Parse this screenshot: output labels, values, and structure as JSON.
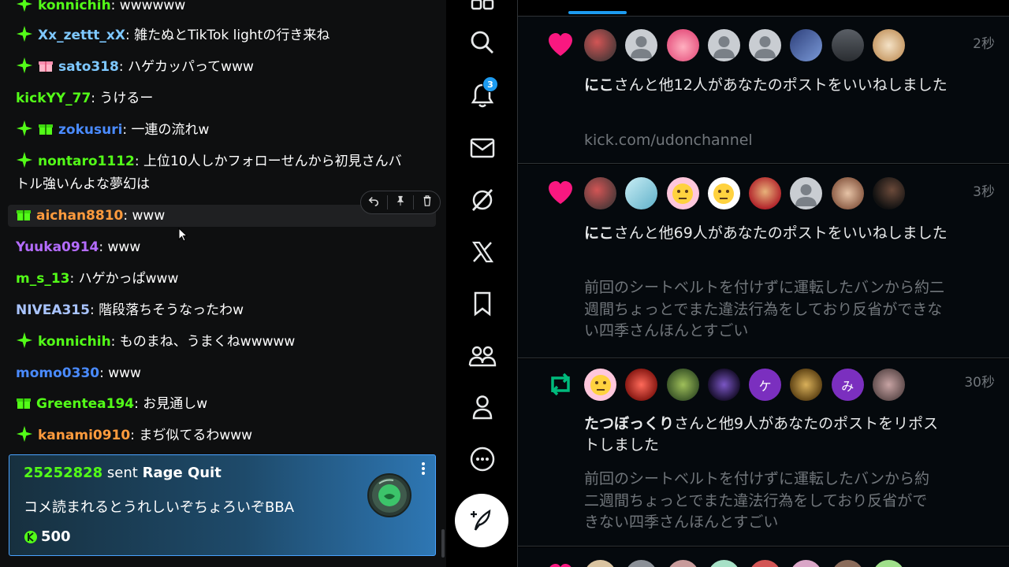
{
  "chat": {
    "messages": [
      {
        "user": "konnichih",
        "text": ": wwwwww",
        "user_color": "#53fc18",
        "badge": "kick-badge"
      },
      {
        "user": "Xx_zettt_xX",
        "text": ": 雑たぬとTikTok lightの行き来ね",
        "user_color": "#7ec8ff",
        "badge": "kick-badge"
      },
      {
        "user": "sato318",
        "text": ": ハゲカッパってwww",
        "user_color": "#7ec8ff",
        "badge": "kick-badge",
        "badge2": "pink-gift-badge"
      },
      {
        "user": "kickYY_77",
        "text": ": うけるー",
        "user_color": "#53fc18"
      },
      {
        "user": "zokusuri",
        "text": ": 一連の流れw",
        "user_color": "#4a8bff",
        "badge": "kick-badge",
        "badge2": "green-gift-badge"
      },
      {
        "user": "nontaro1112",
        "text": ": 上位10人しかフォローせんから初見さんバ",
        "text2": "トル強いんよな夢幻は",
        "user_color": "#53fc18",
        "badge": "kick-badge"
      },
      {
        "user": "aichan8810",
        "text": ": www",
        "user_color": "#ff9b3d",
        "badge": "green-gift-badge"
      },
      {
        "user": "Yuuka0914",
        "text": ": www",
        "user_color": "#b46cff"
      },
      {
        "user": "m_s_13",
        "text": ": ハゲかっぱwww",
        "user_color": "#53fc18"
      },
      {
        "user": "NIVEA315",
        "text": ": 階段落ちそうなったわw",
        "user_color": "#a9c4ff"
      },
      {
        "user": "konnichih",
        "text": ": ものまね、うまくねwwwww",
        "user_color": "#53fc18",
        "badge": "kick-badge"
      },
      {
        "user": "momo0330",
        "text": ": www",
        "user_color": "#4a8bff"
      },
      {
        "user": "Greentea194",
        "text": ": お見通しw",
        "user_color": "#53fc18",
        "badge": "green-gift-badge"
      },
      {
        "user": "kanami0910",
        "text": ": まぢ似てるわwww",
        "user_color": "#ff9b3d",
        "badge": "kick-badge"
      }
    ],
    "gift": {
      "sender": "25252828",
      "verb": " sent ",
      "gift_name": "Rage Quit",
      "message": "コメ読まれるとうれしいぞちょろいぞBBA",
      "amount": "500",
      "menu_icon": "more-vertical-icon"
    },
    "toolbar_icons": [
      "reply-icon",
      "pin-icon",
      "delete-icon"
    ]
  },
  "nav": {
    "items": [
      "grid-icon",
      "search-icon",
      "bell-icon",
      "mail-icon",
      "grok-icon",
      "x-logo-icon",
      "bookmark-icon",
      "communities-icon",
      "profile-icon",
      "more-icon"
    ],
    "notification_count": "3",
    "compose_icon": "compose-icon"
  },
  "notifications": [
    {
      "type": "like",
      "time": "2秒",
      "name": "にこ",
      "text": "さんと他12人があなたのポストをいいねしました",
      "sub": "kick.com/udonchannel",
      "avatar_count": 8
    },
    {
      "type": "like",
      "time": "3秒",
      "name": "にこ",
      "text": "さんと他69人があなたのポストをいいねしました",
      "sub": "前回のシートベルトを付けずに運転したバンから約二週間ちょっとでまた違法行為をしており反省ができない四季さんほんとすごい",
      "avatar_count": 8
    },
    {
      "type": "repost",
      "time": "30秒",
      "name": "たつぼっくり",
      "text": "さんと他9人があなたのポストをリポストしました",
      "sub": "前回のシートベルトを付けずに運転したバンから約二週間ちょっとでまた違法行為をしており反省ができない四季さんほんとすごい",
      "avatar_letters": [
        "ケ",
        "み"
      ],
      "avatar_count": 8
    }
  ],
  "colors": {
    "x_blue": "#1d9bf0",
    "like_pink": "#f91880",
    "repost_green": "#00ba7c",
    "kick_green": "#53fc18"
  }
}
